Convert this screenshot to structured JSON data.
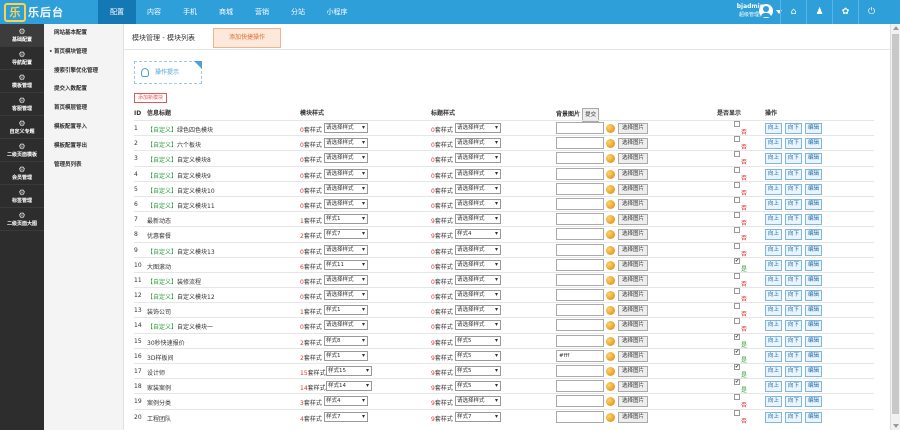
{
  "app": {
    "logo_text": "乐后台",
    "logo_mark": "乐"
  },
  "topnav": {
    "items": [
      "配置",
      "内容",
      "手机",
      "商城",
      "营销",
      "分站",
      "小程序"
    ],
    "active": 0
  },
  "user": {
    "name": "bjadmin",
    "role": "超级管理员"
  },
  "top_icons": [
    "home-icon",
    "sitemap-icon",
    "palette-icon",
    "power-icon"
  ],
  "sidebar": {
    "items": [
      "基础配置",
      "导航配置",
      "模板管理",
      "客服管理",
      "自定义专题",
      "二级页面模板",
      "会员管理",
      "标签管理",
      "二级页面大图"
    ],
    "active": 0
  },
  "subnav": {
    "items": [
      "网站基本配置",
      "首页模块管理",
      "搜索引擎优化管理",
      "提交入数配置",
      "首页模层管理",
      "模板配置导入",
      "模板配置导出",
      "管理员列表"
    ],
    "active": 1
  },
  "page": {
    "breadcrumb": "模块管理 - 模块列表",
    "quick_add": "添加快捷操作",
    "tip": "操作提示",
    "add_button": "添加新模块"
  },
  "table": {
    "headers": {
      "id": "ID",
      "title": "信息标题",
      "module_style": "模块样式",
      "title_style": "标题样式",
      "bg_image": "背景图片",
      "submit": "提交",
      "display": "是否显示",
      "action": "操作"
    },
    "suffix": "套样式",
    "choose_label": "选择图片",
    "yes": "是",
    "no": "否",
    "btn_up": "向上",
    "btn_down": "向下",
    "btn_edit": "编辑",
    "rows": [
      {
        "id": "1",
        "tag": "【自定义】",
        "title": "绿色四色模块",
        "ms_count": "0",
        "ms_sel": "请选择样式",
        "ts_count": "0",
        "ts_sel": "请选择样式",
        "bg": "",
        "show": false
      },
      {
        "id": "2",
        "tag": "【自定义】",
        "title": "六个板块",
        "ms_count": "0",
        "ms_sel": "请选择样式",
        "ts_count": "0",
        "ts_sel": "请选择样式",
        "bg": "",
        "show": false
      },
      {
        "id": "3",
        "tag": "【自定义】",
        "title": "自定义模块8",
        "ms_count": "0",
        "ms_sel": "请选择样式",
        "ts_count": "0",
        "ts_sel": "请选择样式",
        "bg": "",
        "show": false
      },
      {
        "id": "4",
        "tag": "【自定义】",
        "title": "自定义模块9",
        "ms_count": "0",
        "ms_sel": "请选择样式",
        "ts_count": "0",
        "ts_sel": "请选择样式",
        "bg": "",
        "show": false
      },
      {
        "id": "5",
        "tag": "【自定义】",
        "title": "自定义模块10",
        "ms_count": "0",
        "ms_sel": "请选择样式",
        "ts_count": "0",
        "ts_sel": "请选择样式",
        "bg": "",
        "show": false
      },
      {
        "id": "6",
        "tag": "【自定义】",
        "title": "自定义模块11",
        "ms_count": "0",
        "ms_sel": "请选择样式",
        "ts_count": "0",
        "ts_sel": "请选择样式",
        "bg": "",
        "show": false
      },
      {
        "id": "7",
        "tag": "",
        "title": "最新动态",
        "ms_count": "1",
        "ms_sel": "样式1",
        "ts_count": "9",
        "ts_sel": "请选择样式",
        "bg": "",
        "show": false
      },
      {
        "id": "8",
        "tag": "",
        "title": "优惠套餐",
        "ms_count": "2",
        "ms_sel": "样式7",
        "ts_count": "9",
        "ts_sel": "样式4",
        "bg": "",
        "show": false
      },
      {
        "id": "9",
        "tag": "【自定义】",
        "title": "自定义模块13",
        "ms_count": "0",
        "ms_sel": "请选择样式",
        "ts_count": "0",
        "ts_sel": "请选择样式",
        "bg": "",
        "show": false
      },
      {
        "id": "10",
        "tag": "",
        "title": "大图滚动",
        "ms_count": "6",
        "ms_sel": "样式11",
        "ts_count": "0",
        "ts_sel": "请选择样式",
        "bg": "",
        "show": true
      },
      {
        "id": "11",
        "tag": "【自定义】",
        "title": "装修流程",
        "ms_count": "0",
        "ms_sel": "请选择样式",
        "ts_count": "0",
        "ts_sel": "请选择样式",
        "bg": "",
        "show": false
      },
      {
        "id": "12",
        "tag": "【自定义】",
        "title": "自定义模块12",
        "ms_count": "0",
        "ms_sel": "请选择样式",
        "ts_count": "0",
        "ts_sel": "请选择样式",
        "bg": "",
        "show": false
      },
      {
        "id": "13",
        "tag": "",
        "title": "装饰公司",
        "ms_count": "1",
        "ms_sel": "样式1",
        "ts_count": "0",
        "ts_sel": "请选择样式",
        "bg": "",
        "show": false
      },
      {
        "id": "14",
        "tag": "【自定义】",
        "title": "自定义模块一",
        "ms_count": "0",
        "ms_sel": "请选择样式",
        "ts_count": "0",
        "ts_sel": "请选择样式",
        "bg": "",
        "show": false
      },
      {
        "id": "15",
        "tag": "",
        "title": "30秒快速报价",
        "ms_count": "2",
        "ms_sel": "样式8",
        "ts_count": "9",
        "ts_sel": "样式5",
        "bg": "",
        "show": true
      },
      {
        "id": "16",
        "tag": "",
        "title": "3D样板间",
        "ms_count": "2",
        "ms_sel": "样式1",
        "ts_count": "9",
        "ts_sel": "样式5",
        "bg": "#fff",
        "show": true
      },
      {
        "id": "17",
        "tag": "",
        "title": "设计师",
        "ms_count": "15",
        "ms_sel": "样式15",
        "ts_count": "9",
        "ts_sel": "样式5",
        "bg": "",
        "show": true
      },
      {
        "id": "18",
        "tag": "",
        "title": "家装案例",
        "ms_count": "14",
        "ms_sel": "样式14",
        "ts_count": "9",
        "ts_sel": "样式5",
        "bg": "",
        "show": true
      },
      {
        "id": "19",
        "tag": "",
        "title": "案例分类",
        "ms_count": "3",
        "ms_sel": "样式4",
        "ts_count": "9",
        "ts_sel": "请选择样式",
        "bg": "",
        "show": false
      },
      {
        "id": "20",
        "tag": "",
        "title": "工程团队",
        "ms_count": "4",
        "ms_sel": "样式7",
        "ts_count": "9",
        "ts_sel": "样式7",
        "bg": "",
        "show": false
      }
    ]
  }
}
